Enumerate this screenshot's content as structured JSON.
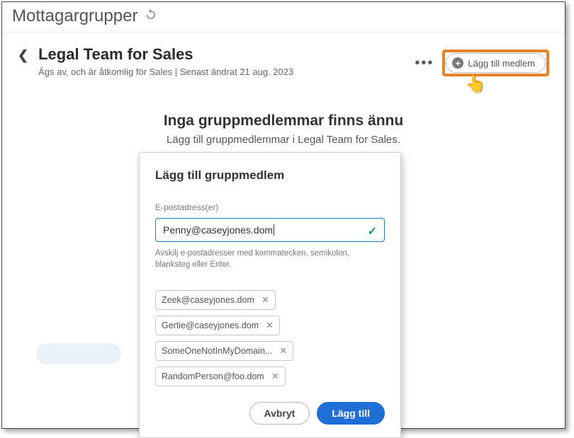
{
  "topbar": {
    "title": "Mottagargrupper"
  },
  "header": {
    "title": "Legal Team for Sales",
    "subtitle": "Ägs av, och är åtkomlig för Sales | Senast ändrat 21 aug. 2023",
    "add_member_label": "Lägg till medlem"
  },
  "empty_state": {
    "title": "Inga gruppmedlemmar finns ännu",
    "subtitle": "Lägg till gruppmedlemmar i Legal Team for Sales."
  },
  "modal": {
    "title": "Lägg till gruppmedlem",
    "field_label": "E-postadress(er)",
    "input_value": "Penny@caseyjones.dom",
    "helper": "Avskilj e-postadresser med kommatecken, semikolon, blanksteg eller Enter.",
    "chips": [
      "Zeek@caseyjones.dom",
      "Gertie@caseyjones.dom",
      "SomeOneNotInMyDomain...",
      "RandomPerson@foo.dom"
    ],
    "cancel_label": "Avbryt",
    "submit_label": "Lägg till"
  }
}
